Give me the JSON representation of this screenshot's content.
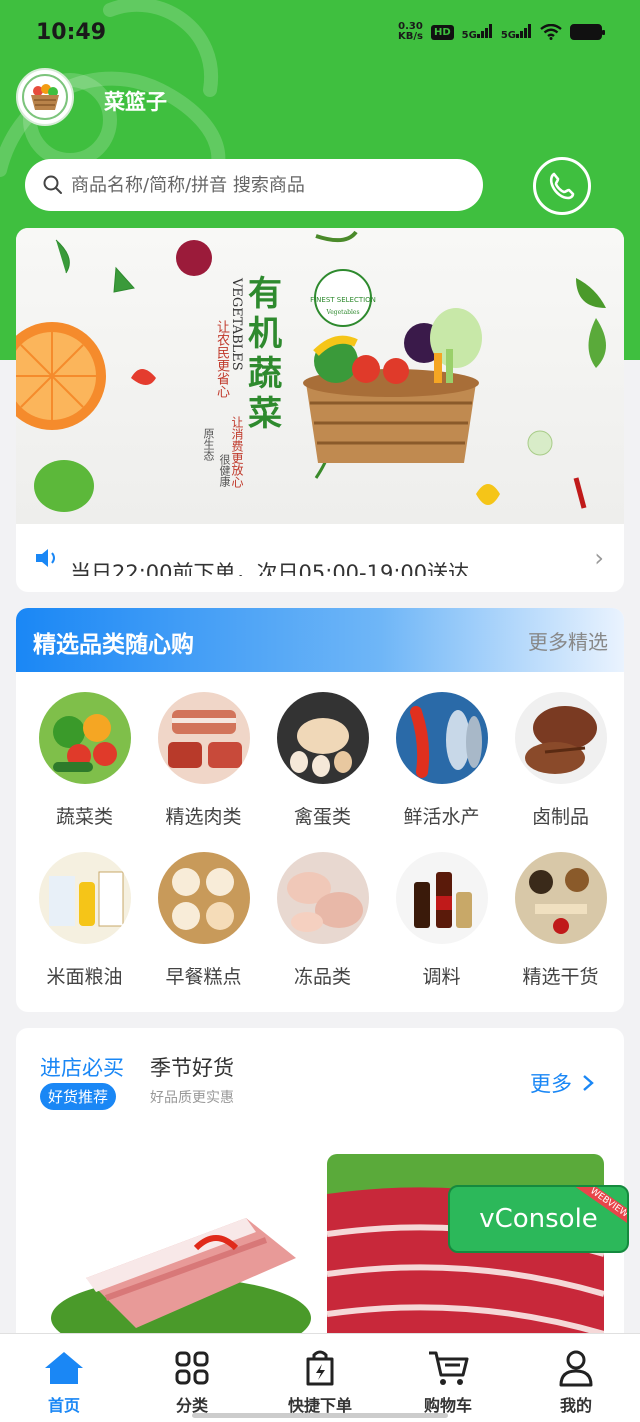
{
  "status_bar": {
    "time": "10:49",
    "net_speed": "0.30",
    "net_unit": "KB/s",
    "hd": "HD",
    "sim1": "5G",
    "sim2": "5G"
  },
  "app": {
    "name": "菜篮子"
  },
  "search": {
    "placeholder": "商品名称/简称/拼音 搜索商品"
  },
  "banner": {
    "title": "有机蔬菜",
    "english": "VEGETABLES",
    "slogan1": "让农民更省心",
    "slogan2": "让消费更放心",
    "note1": "原生态",
    "note2": "很健康",
    "seal_line1": "FINEST SELECTION",
    "seal_line2": "Vegetables"
  },
  "notice": {
    "text": "当日22:00前下单，次日05:00-19:00送达"
  },
  "categories": {
    "title": "精选品类随心购",
    "more": "更多精选",
    "items": [
      {
        "label": "蔬菜类"
      },
      {
        "label": "精选肉类"
      },
      {
        "label": "禽蛋类"
      },
      {
        "label": "鲜活水产"
      },
      {
        "label": "卤制品"
      },
      {
        "label": "米面粮油"
      },
      {
        "label": "早餐糕点"
      },
      {
        "label": "冻品类"
      },
      {
        "label": "调料"
      },
      {
        "label": "精选干货"
      }
    ]
  },
  "recommend": {
    "title1": "进店必买",
    "badge": "好货推荐",
    "title2": "季节好货",
    "subtitle": "好品质更实惠",
    "more": "更多"
  },
  "vconsole": {
    "label": "vConsole",
    "ribbon": "WEBVIEW"
  },
  "tabbar": {
    "items": [
      {
        "label": "首页",
        "icon": "home-icon"
      },
      {
        "label": "分类",
        "icon": "category-icon"
      },
      {
        "label": "快捷下单",
        "icon": "quick-order-icon"
      },
      {
        "label": "购物车",
        "icon": "cart-icon"
      },
      {
        "label": "我的",
        "icon": "profile-icon"
      }
    ]
  },
  "colors": {
    "brand_green": "#3fbf3f",
    "accent_blue": "#1a87f5"
  }
}
